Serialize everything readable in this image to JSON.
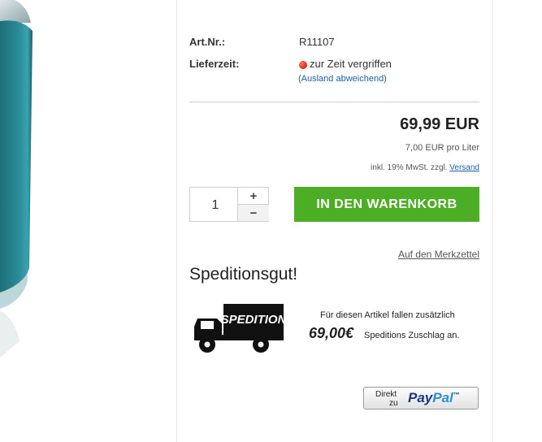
{
  "product": {
    "art_nr_label": "Art.Nr.:",
    "art_nr_value": "R11107",
    "delivery_label": "Lieferzeit:",
    "delivery_status": "zur Zeit vergriffen",
    "delivery_abroad_link": "(Ausland abweichend)",
    "status_color": "#e2341d"
  },
  "pricing": {
    "price": "69,99 EUR",
    "unit_price": "7,00 EUR pro Liter",
    "tax_note": "inkl. 19% MwSt. zzgl.",
    "shipping_link": "Versand"
  },
  "purchase": {
    "quantity": "1",
    "plus_label": "+",
    "minus_label": "−",
    "cart_button_label": "IN DEN WARENKORB",
    "cart_button_color": "#4cae24",
    "wishlist_link": "Auf den Merkzettel"
  },
  "spedition": {
    "title": "Speditionsgut!",
    "truck_label": "SPEDITION",
    "line1": "Für diesen Artikel fallen zusätzlich",
    "amount": "69,00€",
    "line2": "Speditions Zuschlag an."
  },
  "paypal": {
    "direkt": "Direkt",
    "zu": "zu",
    "pay": "Pay",
    "pal": "Pal",
    "tm": "™"
  }
}
